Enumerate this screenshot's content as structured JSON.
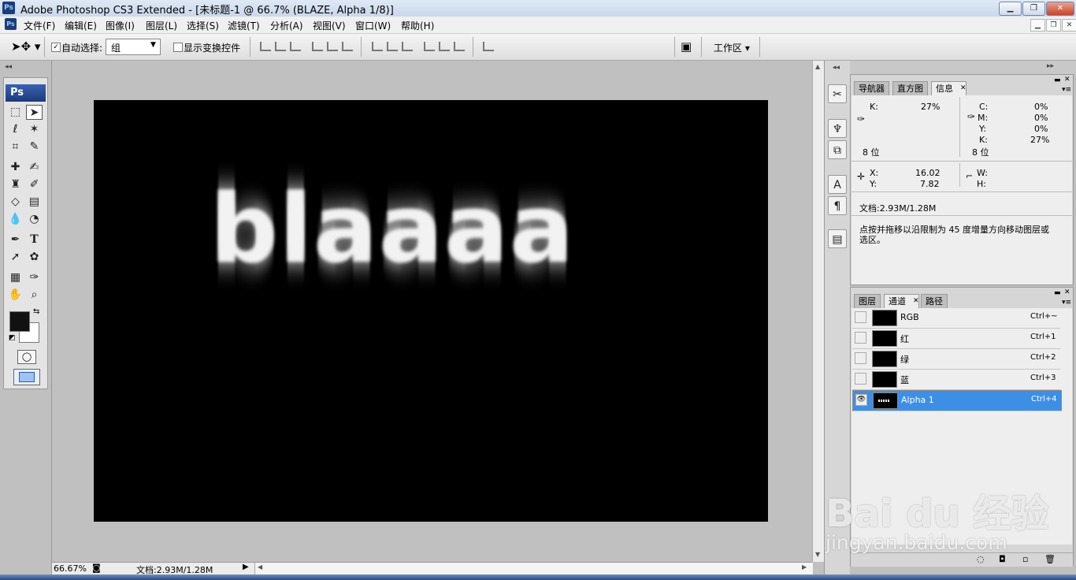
{
  "window": {
    "title": "Adobe Photoshop CS3 Extended - [未标题-1 @ 66.7% (BLAZE, Alpha 1/8)]",
    "app_icon": "Ps"
  },
  "menu": {
    "items": [
      "文件(F)",
      "编辑(E)",
      "图像(I)",
      "图层(L)",
      "选择(S)",
      "滤镜(T)",
      "分析(A)",
      "视图(V)",
      "窗口(W)",
      "帮助(H)"
    ]
  },
  "options": {
    "auto_select_label": "自动选择:",
    "auto_select_checked": true,
    "auto_select_value": "组",
    "show_transform_label": "显示变换控件",
    "show_transform_checked": false,
    "workspace_label": "工作区 ▾"
  },
  "toolbox": {
    "logo": "Ps"
  },
  "canvas": {
    "text": "blaaaa",
    "background": "#000000"
  },
  "status": {
    "zoom": "66.67%",
    "doc": "文档:2.93M/1.28M"
  },
  "info_panel": {
    "tabs": [
      "导航器",
      "直方图",
      "信息"
    ],
    "active_tab": 2,
    "left_k_label": "K:",
    "left_k_value": "27%",
    "left_bits": "8 位",
    "c_label": "C:",
    "c_value": "0%",
    "m_label": "M:",
    "m_value": "0%",
    "y_label": "Y:",
    "y_value": "0%",
    "k_label": "K:",
    "k_value": "27%",
    "right_bits": "8 位",
    "x_label": "X:",
    "x_value": "16.02",
    "yy_label": "Y:",
    "yy_value": "7.82",
    "w_label": "W:",
    "h_label": "H:",
    "doc": "文档:2.93M/1.28M",
    "hint": "点按并拖移以沿限制为 45 度增量方向移动图层或选区。"
  },
  "channels_panel": {
    "tabs": [
      "图层",
      "通道",
      "路径"
    ],
    "active_tab": 1,
    "rows": [
      {
        "name": "RGB",
        "key": "Ctrl+~",
        "visible": false,
        "selected": false
      },
      {
        "name": "红",
        "key": "Ctrl+1",
        "visible": false,
        "selected": false
      },
      {
        "name": "绿",
        "key": "Ctrl+2",
        "visible": false,
        "selected": false
      },
      {
        "name": "蓝",
        "key": "Ctrl+3",
        "visible": false,
        "selected": false
      },
      {
        "name": "Alpha 1",
        "key": "Ctrl+4",
        "visible": true,
        "selected": true
      }
    ]
  },
  "watermark": {
    "line1": "Bai du 经验",
    "line2": "jingyan.baidu.com"
  },
  "colors": {
    "selection": "#3d8fe6",
    "title_bg": "#c9d8ec",
    "panel_bg": "#d6d6d6"
  }
}
